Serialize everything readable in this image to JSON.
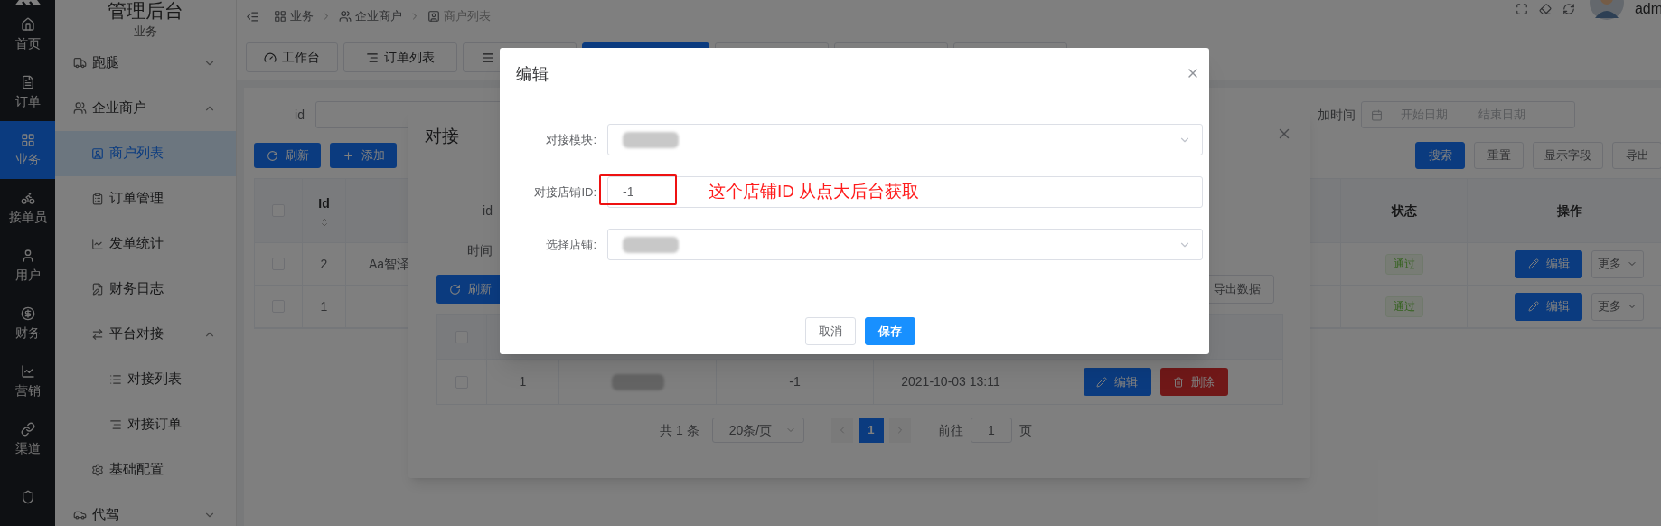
{
  "rail": {
    "items": [
      {
        "label": "首页",
        "selected": false
      },
      {
        "label": "订单",
        "selected": false
      },
      {
        "label": "业务",
        "selected": true
      },
      {
        "label": "接单员",
        "selected": false
      },
      {
        "label": "用户",
        "selected": false
      },
      {
        "label": "财务",
        "selected": false
      },
      {
        "label": "营销",
        "selected": false
      },
      {
        "label": "渠道",
        "selected": false
      },
      {
        "selected": false
      }
    ]
  },
  "sidebar": {
    "title": "管理后台",
    "subtitle": "业务",
    "items": [
      {
        "label": "跑腿",
        "expanded": false
      },
      {
        "label": "企业商户",
        "expanded": true,
        "children": [
          {
            "label": "商户列表",
            "selected": true
          },
          {
            "label": "订单管理",
            "selected": false
          },
          {
            "label": "发单统计",
            "selected": false
          },
          {
            "label": "财务日志",
            "selected": false
          },
          {
            "label": "平台对接",
            "selected": false,
            "expanded": true,
            "children": [
              {
                "label": "对接列表",
                "selected": false
              },
              {
                "label": "对接订单",
                "selected": false
              }
            ]
          },
          {
            "label": "基础配置",
            "selected": false
          }
        ]
      },
      {
        "label": "代驾",
        "expanded": false
      }
    ]
  },
  "breadcrumb": [
    "业务",
    "企业商户",
    "商户列表"
  ],
  "header": {
    "user": "adm"
  },
  "tabs": [
    {
      "label": "工作台",
      "selected": false
    },
    {
      "label": "订单列表",
      "selected": false
    },
    {
      "selected": false
    },
    {
      "selected": true
    },
    {
      "selected": false
    },
    {
      "selected": false
    },
    {
      "selected": false
    }
  ],
  "filters": {
    "id_label": "id",
    "date_label": "加时间",
    "date_start_placeholder": "开始日期",
    "date_end_placeholder": "结束日期"
  },
  "toolbar": {
    "left": [
      {
        "label": "刷新",
        "kind": "refresh"
      },
      {
        "label": "添加",
        "kind": "add"
      }
    ],
    "right": [
      {
        "label": "搜索",
        "kind": "primary"
      },
      {
        "label": "重置",
        "kind": "default"
      },
      {
        "label": "显示字段",
        "kind": "default"
      },
      {
        "label": "导出",
        "kind": "default"
      }
    ]
  },
  "table": {
    "header_checked": false,
    "columns": {
      "id": "Id",
      "status": "状态",
      "actions": "操作"
    },
    "rows": [
      {
        "checked": false,
        "id": "2",
        "name": "Aa智泽",
        "status": "通过",
        "edit": "编辑",
        "more": "更多"
      },
      {
        "checked": false,
        "id": "1",
        "status": "通过",
        "edit": "编辑",
        "more": "更多"
      }
    ]
  },
  "connect_dialog": {
    "title": "对接",
    "filter_labels": [
      "id",
      "时间"
    ],
    "refresh": "刷新",
    "export": "导出数据",
    "header_checked": false,
    "rows": [
      {
        "checked": false,
        "id": "1",
        "name_redacted": true,
        "shop_id": "-1",
        "time": "2021-10-03 13:11",
        "edit": "编辑",
        "delete": "删除"
      }
    ],
    "pagination": {
      "total": "共 1 条",
      "page_size": "20条/页",
      "pages": [
        {
          "label": "1",
          "selected": true
        }
      ],
      "goto_label": "前往",
      "goto_value": "1",
      "goto_suffix": "页"
    }
  },
  "edit_dialog": {
    "title": "编辑",
    "fields": [
      {
        "label": "对接模块:",
        "kind": "select",
        "redacted": true
      },
      {
        "label": "对接店铺ID:",
        "kind": "input",
        "value": "-1"
      },
      {
        "label": "选择店铺:",
        "kind": "select",
        "redacted": true
      }
    ],
    "annotation": "这个店铺ID 从点大后台获取",
    "buttons": [
      {
        "label": "取消",
        "kind": "default"
      },
      {
        "label": "保存",
        "kind": "primary"
      }
    ]
  }
}
